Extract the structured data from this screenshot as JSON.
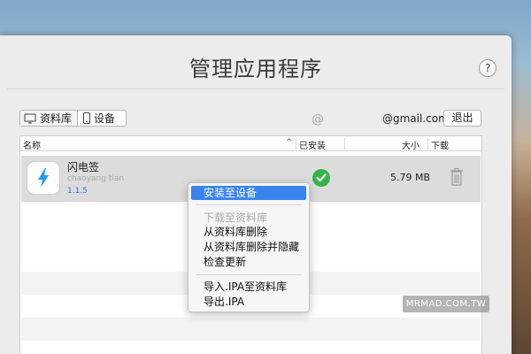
{
  "window": {
    "title": "管理应用程序",
    "help_label": "?"
  },
  "toolbar": {
    "segments": [
      {
        "label": "资料库",
        "icon": "monitor-icon",
        "selected": true
      },
      {
        "label": "设备",
        "icon": "phone-icon",
        "selected": false
      }
    ],
    "at_symbol": "@",
    "account_email": "@gmail.com",
    "logout_label": "退出"
  },
  "table": {
    "columns": {
      "name": "名称",
      "sort": "^",
      "installed": "已安装",
      "size": "大小",
      "download": "下载"
    },
    "rows": [
      {
        "name": "闪电签",
        "author": "chaoyang tian",
        "version": "1.1.5",
        "installed": true,
        "size": "5.79 MB",
        "icon": "lightning-icon"
      }
    ]
  },
  "context_menu": {
    "items": [
      {
        "label": "安装至设备",
        "highlighted": true,
        "disabled": false
      },
      {
        "label": "下载至资料库",
        "highlighted": false,
        "disabled": true
      },
      {
        "label": "从资料库删除",
        "highlighted": false,
        "disabled": false
      },
      {
        "label": "从资料库删除并隐藏",
        "highlighted": false,
        "disabled": false
      },
      {
        "label": "检查更新",
        "highlighted": false,
        "disabled": false
      },
      {
        "label": "导入.IPA至资料库",
        "highlighted": false,
        "disabled": false
      },
      {
        "label": "导出.IPA",
        "highlighted": false,
        "disabled": false
      }
    ]
  },
  "watermark": "MRMAD.COM.TW",
  "colors": {
    "accent": "#3a84f2",
    "installed": "#35b34a",
    "version": "#2f6fd6",
    "lightning": "#1e9bf0"
  }
}
